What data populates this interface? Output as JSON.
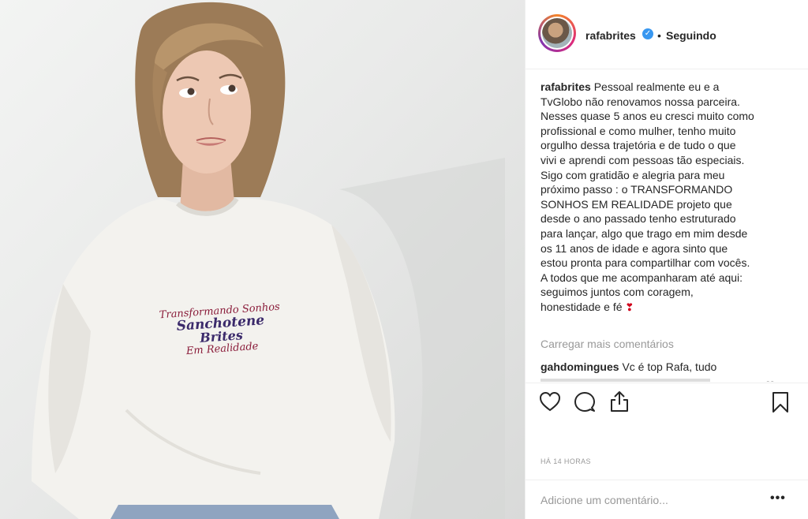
{
  "post_image": {
    "shirt_print": {
      "line1": "Transformando Sonhos",
      "line2": "Sanchotene",
      "line3": "Brites",
      "line4": "Em Realidade"
    }
  },
  "header": {
    "username": "rafabrites",
    "separator": "•",
    "follow_status": "Seguindo"
  },
  "caption": {
    "username": "rafabrites",
    "text": "Pessoal realmente eu e a\nTvGlobo não renovamos nossa parceira.\nNesses quase 5 anos eu cresci muito como\nprofissional e como mulher, tenho muito\norgulho dessa trajetória e de tudo o que\nvivi e aprendi com pessoas tão especiais.\nSigo com gratidão e alegria para meu\npróximo passo : o TRANSFORMANDO\nSONHOS EM REALIDADE projeto que\ndesde o ano passado tenho estruturado\npara lançar, algo que trago em mim desde\nos 11 anos de idade e agora sinto que\nestou pronta para compartilhar com vocês.\nA todos que me acompanharam até aqui:\nseguimos juntos com coragem,\nhonestidade e fé",
    "emoji": "❣"
  },
  "load_more": "Carregar mais comentários",
  "comments": [
    {
      "username": "gahdomingues",
      "text": "Vc é top Rafa, tudo"
    }
  ],
  "timestamp": "HÁ 14 HORAS",
  "comment_input": {
    "placeholder": "Adicione um comentário..."
  },
  "more_options": "•••",
  "icons": {
    "like": "heart-icon",
    "comment": "comment-icon",
    "share": "share-icon",
    "save": "bookmark-icon",
    "verified": "verified-badge-icon"
  },
  "colors": {
    "verified_blue": "#3897f0",
    "muted_text": "#999999",
    "text": "#262626"
  }
}
